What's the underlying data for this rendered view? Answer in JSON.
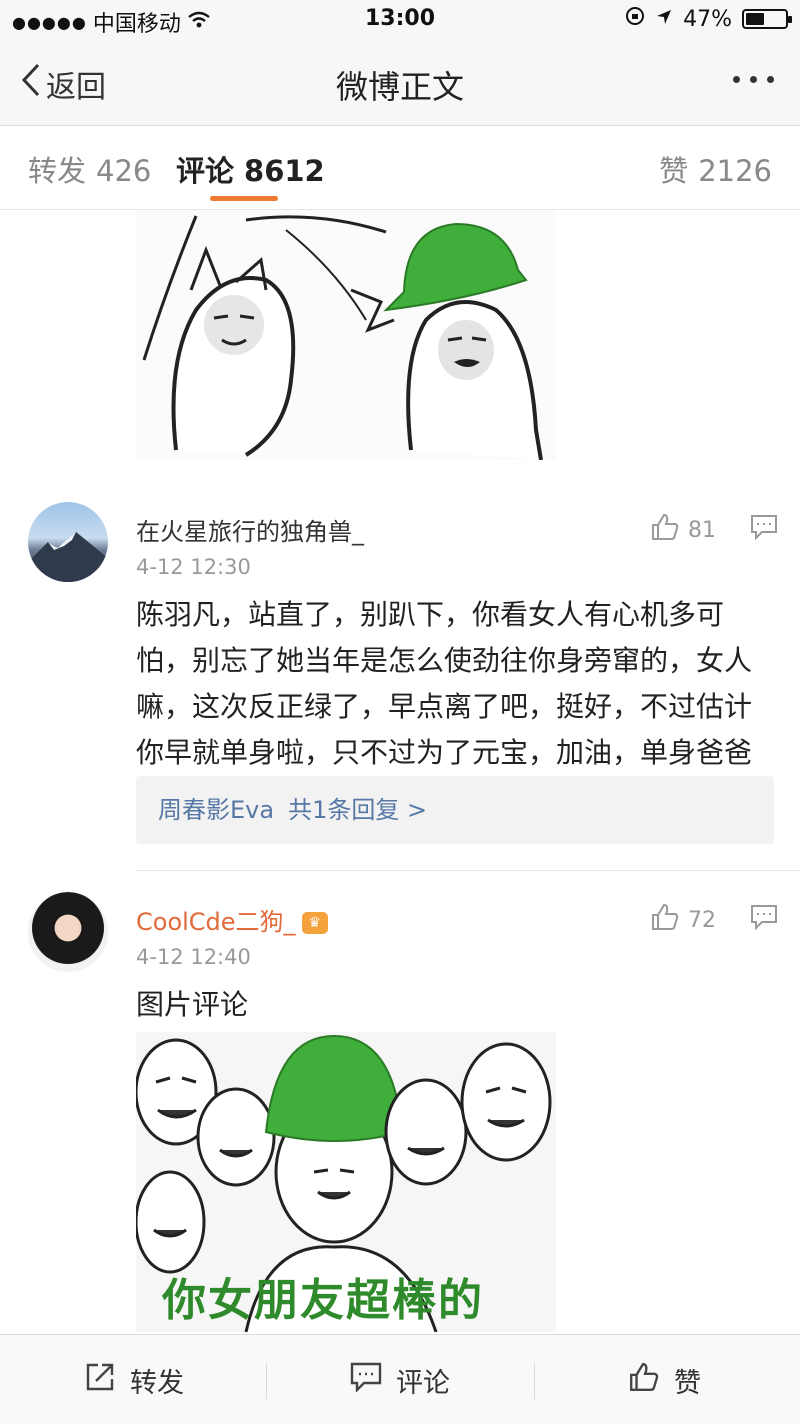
{
  "status_bar": {
    "signal": "●●●●●",
    "carrier": "中国移动",
    "time": "13:00",
    "battery_pct": "47%",
    "battery_level": 0.47
  },
  "nav": {
    "back_label": "返回",
    "title": "微博正文"
  },
  "tabs": {
    "repost_label": "转发",
    "repost_count": "426",
    "comment_label": "评论",
    "comment_count": "8612",
    "like_label": "赞",
    "like_count": "2126"
  },
  "comments": [
    {
      "name": "在火星旅行的独角兽_",
      "time": "4-12 12:30",
      "likes": "81",
      "text": "陈羽凡，站直了，别趴下，你看女人有心机多可怕，别忘了她当年是怎么使劲往你身旁窜的，女人嘛，这次反正绿了，早点离了吧，挺好，不过估计你早就单身啦，只不过为了元宝，加油，单身爸爸",
      "reply_user": "周春影Eva",
      "reply_count": "共1条回复 >"
    },
    {
      "name": "CoolCde二狗_",
      "time": "4-12 12:40",
      "likes": "72",
      "text": "图片评论",
      "image_caption": "你女朋友超棒的"
    }
  ],
  "toolbar": {
    "repost_label": "转发",
    "comment_label": "评论",
    "like_label": "赞"
  },
  "colors": {
    "accent": "#f07a33",
    "link": "#5778a6",
    "vip_name": "#e06a3a",
    "hat_green": "#3fae3a"
  }
}
